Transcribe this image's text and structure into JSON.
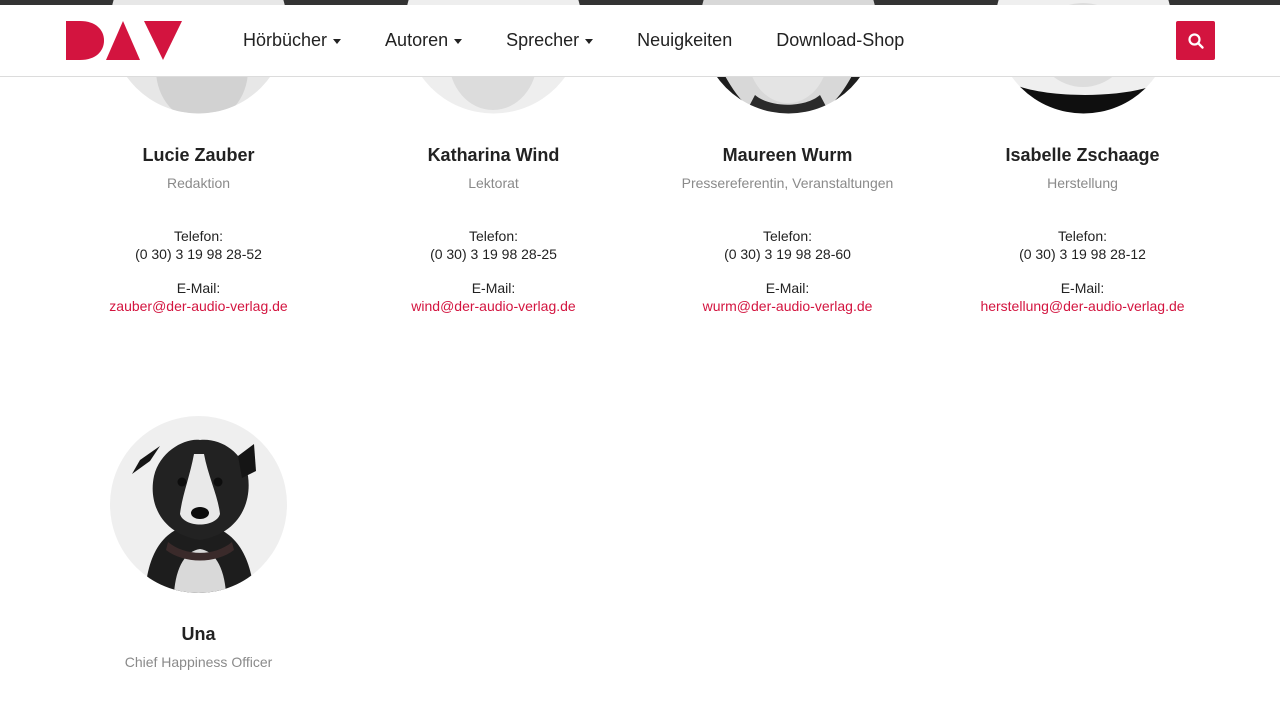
{
  "brand": {
    "logo_text": "DAV",
    "accent": "#d3143f"
  },
  "nav": {
    "items": [
      {
        "label": "Hörbücher",
        "dropdown": true
      },
      {
        "label": "Autoren",
        "dropdown": true
      },
      {
        "label": "Sprecher",
        "dropdown": true
      },
      {
        "label": "Neuigkeiten",
        "dropdown": false
      },
      {
        "label": "Download-Shop",
        "dropdown": false
      }
    ],
    "search_icon": "search-icon"
  },
  "people": [
    {
      "name": "Lucie Zauber",
      "role": "Redaktion",
      "phone_label": "Telefon:",
      "phone": "(0 30) 3 19 98 28-52",
      "email_label": "E-Mail:",
      "email": "zauber@der-audio-verlag.de"
    },
    {
      "name": "Katharina Wind",
      "role": "Lektorat",
      "phone_label": "Telefon:",
      "phone": "(0 30) 3 19 98 28-25",
      "email_label": "E-Mail:",
      "email": "wind@der-audio-verlag.de"
    },
    {
      "name": "Maureen Wurm",
      "role": "Pressereferentin, Veranstaltungen",
      "phone_label": "Telefon:",
      "phone": "(0 30) 3 19 98 28-60",
      "email_label": "E-Mail:",
      "email": "wurm@der-audio-verlag.de"
    },
    {
      "name": "Isabelle Zschaage",
      "role": "Herstellung",
      "phone_label": "Telefon:",
      "phone": "(0 30) 3 19 98 28-12",
      "email_label": "E-Mail:",
      "email": "herstellung@der-audio-verlag.de"
    },
    {
      "name": "Una",
      "role": "Chief Happiness Officer"
    }
  ]
}
